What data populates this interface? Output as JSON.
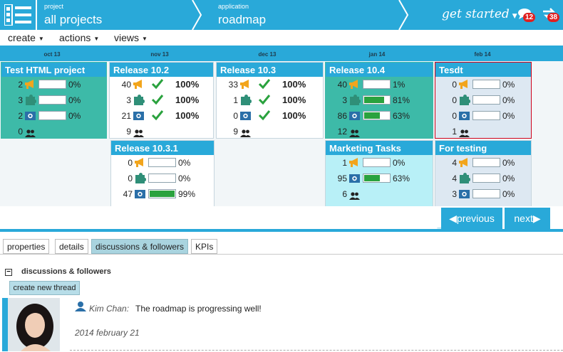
{
  "header": {
    "breadcrumbs": [
      {
        "label": "project",
        "value": "all projects"
      },
      {
        "label": "application",
        "value": "roadmap"
      }
    ],
    "get_started": "get started",
    "chat_count": "12",
    "sync_count": "38"
  },
  "menu": {
    "items": [
      "create",
      "actions",
      "views"
    ]
  },
  "timeline": {
    "months": [
      "oct 13",
      "nov 13",
      "dec 13",
      "jan 14",
      "feb 14"
    ]
  },
  "releases": [
    {
      "title": "Test HTML project",
      "rows": [
        {
          "count": "2",
          "icon": "megaphone-icon",
          "pct": "0%",
          "fill": 0
        },
        {
          "count": "3",
          "icon": "puzzle-icon",
          "pct": "0%",
          "fill": 0
        },
        {
          "count": "2",
          "icon": "bug-icon",
          "pct": "0%",
          "fill": 0
        }
      ],
      "people": "0"
    },
    {
      "title": "Release 10.2",
      "rows": [
        {
          "count": "40",
          "icon": "megaphone-icon",
          "pct": "100%",
          "done": true
        },
        {
          "count": "3",
          "icon": "puzzle-icon",
          "pct": "100%",
          "done": true
        },
        {
          "count": "21",
          "icon": "bug-icon",
          "pct": "100%",
          "done": true
        }
      ],
      "people": "9"
    },
    {
      "title": "Release 10.3",
      "rows": [
        {
          "count": "33",
          "icon": "megaphone-icon",
          "pct": "100%",
          "done": true
        },
        {
          "count": "1",
          "icon": "puzzle-icon",
          "pct": "100%",
          "done": true
        },
        {
          "count": "0",
          "icon": "bug-icon",
          "pct": "100%",
          "done": true
        }
      ],
      "people": "9"
    },
    {
      "title": "Release 10.4",
      "rows": [
        {
          "count": "40",
          "icon": "megaphone-icon",
          "pct": "1%",
          "fill": 0.01
        },
        {
          "count": "3",
          "icon": "puzzle-icon",
          "pct": "81%",
          "fill": 0.81
        },
        {
          "count": "86",
          "icon": "bug-icon",
          "pct": "63%",
          "fill": 0.63
        }
      ],
      "people": "12"
    },
    {
      "title": "Tesdt",
      "rows": [
        {
          "count": "0",
          "icon": "megaphone-icon",
          "pct": "0%",
          "fill": 0
        },
        {
          "count": "0",
          "icon": "puzzle-icon",
          "pct": "0%",
          "fill": 0
        },
        {
          "count": "0",
          "icon": "bug-icon",
          "pct": "0%",
          "fill": 0
        }
      ],
      "people": "1"
    },
    {
      "title": "Release 10.3.1",
      "rows": [
        {
          "count": "0",
          "icon": "megaphone-icon",
          "pct": "0%",
          "fill": 0
        },
        {
          "count": "0",
          "icon": "puzzle-icon",
          "pct": "0%",
          "fill": 0
        },
        {
          "count": "47",
          "icon": "bug-icon",
          "pct": "99%",
          "fill": 0.99
        }
      ]
    },
    {
      "title": "Marketing Tasks",
      "rows": [
        {
          "count": "1",
          "icon": "megaphone-icon",
          "pct": "0%",
          "fill": 0
        },
        {
          "count": "95",
          "icon": "bug-icon",
          "pct": "63%",
          "fill": 0.63
        }
      ],
      "people": "6"
    },
    {
      "title": "For testing",
      "rows": [
        {
          "count": "4",
          "icon": "megaphone-icon",
          "pct": "0%",
          "fill": 0
        },
        {
          "count": "4",
          "icon": "puzzle-icon",
          "pct": "0%",
          "fill": 0
        },
        {
          "count": "3",
          "icon": "bug-icon",
          "pct": "0%",
          "fill": 0
        }
      ]
    }
  ],
  "pager": {
    "previous": "previous",
    "next": "next"
  },
  "tabs": [
    "properties",
    "details",
    "discussions & followers",
    "KPIs"
  ],
  "discussion": {
    "section_title": "discussions & followers",
    "create_button": "create new thread",
    "post": {
      "author": "Kim Chan:",
      "message": "The roadmap is progressing well!",
      "date": "2014 february 21"
    }
  },
  "colors": {
    "accent": "#29a9d9",
    "progress": "#2aa23e",
    "complete": "#2aa23e",
    "badge": "#e02020"
  }
}
